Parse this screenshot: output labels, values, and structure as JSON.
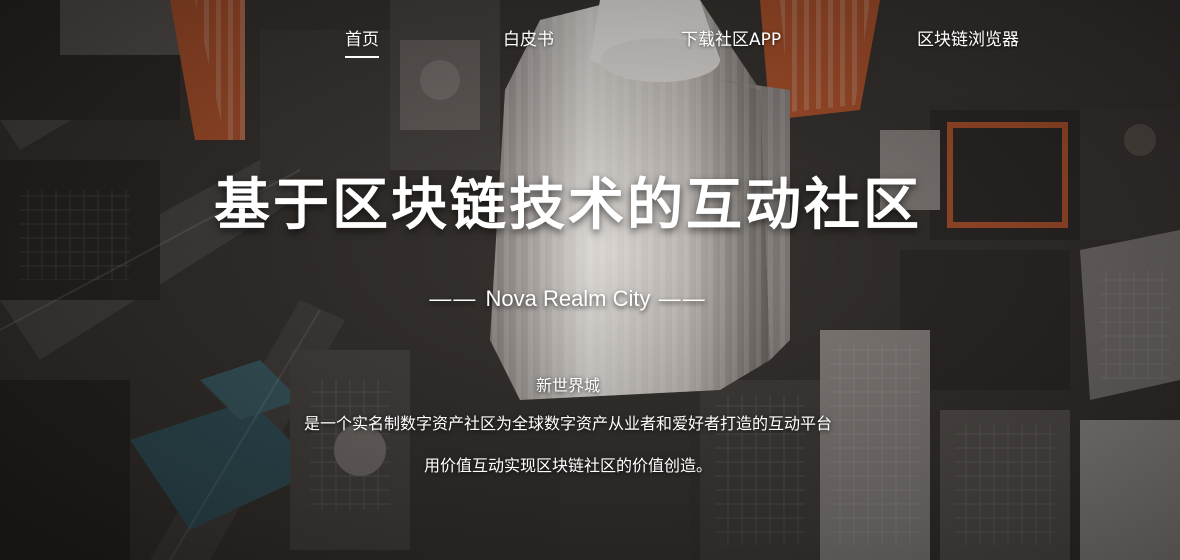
{
  "nav": {
    "items": [
      {
        "label": "首页",
        "active": true
      },
      {
        "label": "白皮书",
        "active": false
      },
      {
        "label": "下载社区APP",
        "active": false
      },
      {
        "label": "区块链浏览器",
        "active": false
      }
    ]
  },
  "hero": {
    "title": "基于区块链技术的互动社区",
    "subtitle_prefix": "—— ",
    "subtitle": "Nova Realm City",
    "subtitle_suffix": " ——",
    "tagline": "新世界城",
    "description_line1": "是一个实名制数字资产社区为全球数字资产从业者和爱好者打造的互动平台",
    "description_line2": "用价值互动实现区块链社区的价值创造。"
  },
  "colors": {
    "text": "#ffffff",
    "background_dark": "#2a2624",
    "accent_orange": "#b2552e"
  }
}
